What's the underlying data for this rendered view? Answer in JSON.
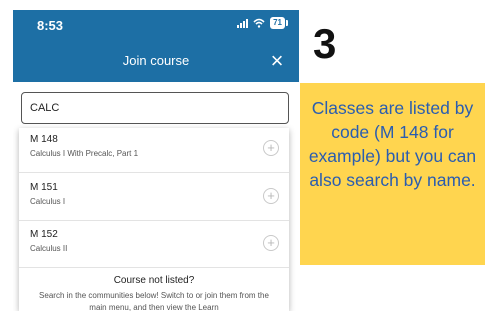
{
  "status_bar": {
    "time": "8:53",
    "battery_level": "71",
    "icons": [
      "signal-icon",
      "wifi-icon",
      "battery-icon"
    ]
  },
  "nav": {
    "title": "Join course",
    "close_icon": "close-icon"
  },
  "search": {
    "value": "CALC"
  },
  "results": [
    {
      "code": "M 148",
      "name": "Calculus I With Precalc, Part 1",
      "icon": "add-circle-icon"
    },
    {
      "code": "M 151",
      "name": "Calculus I",
      "icon": "add-circle-icon"
    },
    {
      "code": "M 152",
      "name": "Calculus II",
      "icon": "add-circle-icon"
    }
  ],
  "not_listed": {
    "title": "Course not listed?",
    "body": "Search in the communities below! Switch to or join them from the main menu, and then view the Learn"
  },
  "annotation": {
    "step_number": "3",
    "callout_text": "Classes are listed by code (M 148 for example) but you can also search by name."
  },
  "colors": {
    "header": "#1d6fa5",
    "callout_bg": "#ffd54f",
    "callout_text": "#2a5db0"
  }
}
